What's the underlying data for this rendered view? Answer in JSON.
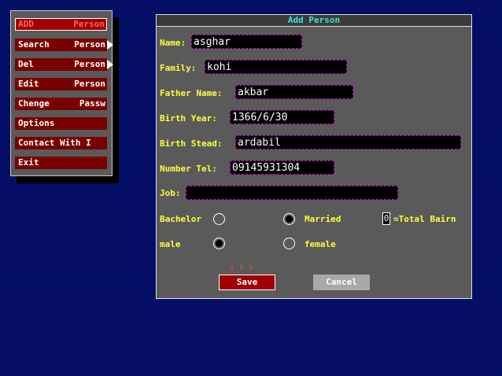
{
  "menu": {
    "items": [
      {
        "label": "ADD",
        "right": "Person",
        "selected": true
      },
      {
        "label": "Search",
        "right": "Person",
        "submenu": true
      },
      {
        "label": "Del",
        "right": "Person",
        "submenu": true
      },
      {
        "label": "Edit",
        "right": "Person"
      },
      {
        "label": "Chenge",
        "right": "Passw"
      },
      {
        "label": "Options",
        "right": ""
      },
      {
        "label": "Contact With I",
        "right": ""
      },
      {
        "label": "Exit",
        "right": ""
      }
    ]
  },
  "dialog": {
    "title": "Add Person",
    "name_label": "Name:",
    "name_value": "asghar",
    "family_label": "Family:",
    "family_value": "kohi",
    "father_label": "Father Name:",
    "father_value": "akbar",
    "birthyear_label": "Birth Year:",
    "birthyear_value": "1366/6/30",
    "birthstead_label": "Birth Stead:",
    "birthstead_value": "ardabil",
    "tel_label": "Number Tel:",
    "tel_value": "09145931304",
    "job_label": "Job:",
    "job_value": "",
    "bachelor_label": "Bachelor",
    "married_label": "Married",
    "total_bairn_label": "=Total Bairn",
    "total_bairn_value": "0",
    "male_label": "male",
    "female_label": "female",
    "marital_status": "Married",
    "gender": "male",
    "arrows": "↓ ↓ ↓",
    "save_label": "Save",
    "cancel_label": "Cancel"
  }
}
